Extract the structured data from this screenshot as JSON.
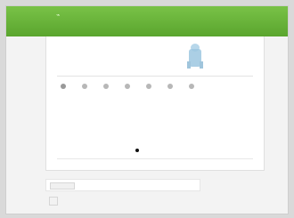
{
  "header": {
    "logo_mark": "⌁",
    "logo_name": "",
    "top_right_line1": "",
    "top_right_line2": ""
  },
  "content": {
    "left_title": "",
    "center_title": "",
    "right_title": "",
    "left_text": "",
    "center_text": "",
    "right_text": "",
    "pager_label": ""
  },
  "tags": [
    {
      "text": ""
    },
    {
      "text": ""
    },
    {
      "text": ""
    },
    {
      "text": ""
    },
    {
      "text": ""
    },
    {
      "text": ""
    },
    {
      "text": ""
    },
    {
      "text": ""
    },
    {
      "text": ""
    },
    {
      "text": ""
    },
    {
      "text": ""
    },
    {
      "text": ""
    },
    {
      "text": ""
    },
    {
      "text": ""
    },
    {
      "text": ""
    },
    {
      "text": ""
    },
    {
      "text": ""
    }
  ],
  "bottom": {
    "left": "",
    "mid": ""
  },
  "footer": {
    "button": "",
    "text": "",
    "link": ""
  },
  "meta_lines": {
    "line1": "",
    "line2": ""
  }
}
